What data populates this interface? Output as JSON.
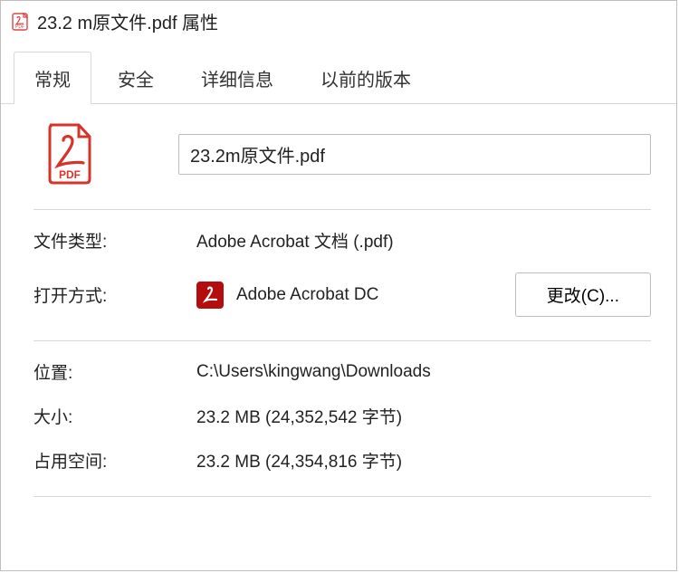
{
  "titlebar": {
    "title": "23.2 m原文件.pdf 属性"
  },
  "tabs": {
    "general": "常规",
    "security": "安全",
    "details": "详细信息",
    "previous": "以前的版本"
  },
  "file": {
    "icon_label": "PDF",
    "name": "23.2m原文件.pdf"
  },
  "rows": {
    "type_label": "文件类型:",
    "type_value": "Adobe Acrobat 文档 (.pdf)",
    "open_with_label": "打开方式:",
    "open_with_value": "Adobe Acrobat DC",
    "change_button": "更改(C)...",
    "location_label": "位置:",
    "location_value": "C:\\Users\\kingwang\\Downloads",
    "size_label": "大小:",
    "size_value": "23.2 MB (24,352,542 字节)",
    "disk_label": "占用空间:",
    "disk_value": "23.2 MB (24,354,816 字节)"
  }
}
